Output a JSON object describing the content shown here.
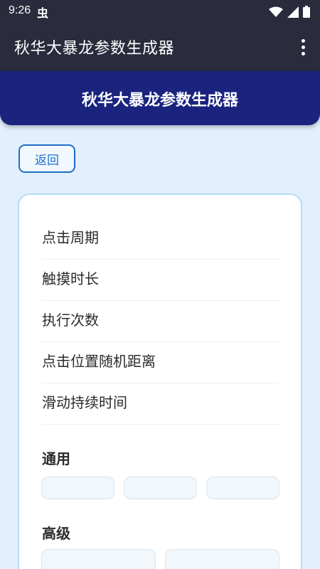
{
  "status_bar": {
    "time": "9:26",
    "notification_glyph": "虫",
    "icons": [
      "wifi-icon",
      "signal-icon",
      "battery-icon"
    ]
  },
  "app_bar": {
    "title": "秋华大暴龙参数生成器",
    "menu_icon": "more-vert-icon"
  },
  "banner": {
    "title": "秋华大暴龙参数生成器"
  },
  "back_button": {
    "label": "返回"
  },
  "params": [
    {
      "label": "点击周期"
    },
    {
      "label": "触摸时长"
    },
    {
      "label": "执行次数"
    },
    {
      "label": "点击位置随机距离"
    },
    {
      "label": "滑动持续时间"
    }
  ],
  "sections": {
    "general": {
      "title": "通用"
    },
    "advanced": {
      "title": "高级"
    }
  },
  "colors": {
    "app_bar": "#2a2b3c",
    "banner": "#1a237e",
    "accent": "#1e6ec8",
    "background": "#e3effc",
    "card_border": "#b3ddf5"
  }
}
